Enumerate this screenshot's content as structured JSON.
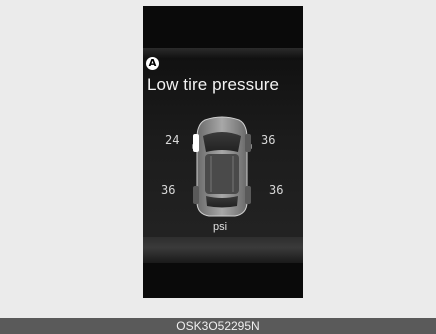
{
  "display": {
    "marker_label": "A",
    "title": "Low tire pressure",
    "unit": "psi",
    "tires": {
      "front_left": "24",
      "front_right": "36",
      "rear_left": "36",
      "rear_right": "36"
    },
    "low_tire": "front_left"
  },
  "footer": {
    "code": "OSK3O52295N"
  },
  "colors": {
    "background": "#ebebeb",
    "display_bg": "#0a0a0a",
    "footer_bg": "#5a5a5a",
    "warning_highlight": "#ffffff"
  },
  "icons": [
    "car-topview-icon",
    "low-tire-indicator"
  ]
}
